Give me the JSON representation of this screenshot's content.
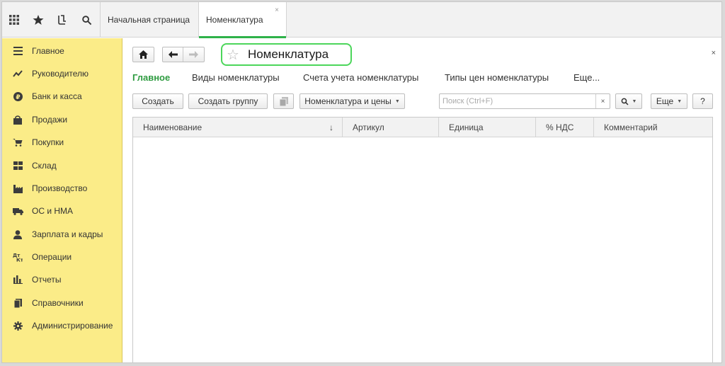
{
  "topbar": {
    "icons": [
      "apps-grid-icon",
      "favorites-star-icon",
      "history-icon",
      "search-icon"
    ],
    "tabs": [
      {
        "label": "Начальная страница"
      },
      {
        "label": "Номенклатура",
        "close": "×"
      }
    ]
  },
  "sidebar": {
    "items": [
      {
        "label": "Главное",
        "icon": "menu-lines-icon"
      },
      {
        "label": "Руководителю",
        "icon": "trend-chart-icon"
      },
      {
        "label": "Банк и касса",
        "icon": "ruble-coin-icon"
      },
      {
        "label": "Продажи",
        "icon": "shopping-bag-icon"
      },
      {
        "label": "Покупки",
        "icon": "cart-icon"
      },
      {
        "label": "Склад",
        "icon": "warehouse-grid-icon"
      },
      {
        "label": "Производство",
        "icon": "factory-icon"
      },
      {
        "label": "ОС и НМА",
        "icon": "truck-icon"
      },
      {
        "label": "Зарплата и кадры",
        "icon": "person-icon"
      },
      {
        "label": "Операции",
        "icon": "debit-credit-icon"
      },
      {
        "label": "Отчеты",
        "icon": "bar-chart-icon"
      },
      {
        "label": "Справочники",
        "icon": "book-icon"
      },
      {
        "label": "Администрирование",
        "icon": "gear-icon"
      }
    ]
  },
  "main": {
    "title": "Номенклатура",
    "close": "×",
    "subnav": [
      "Главное",
      "Виды номенклатуры",
      "Счета учета номенклатуры",
      "Типы цен номенклатуры",
      "Еще..."
    ],
    "toolbar": {
      "create": "Создать",
      "create_group": "Создать группу",
      "nomenclature_prices": "Номенклатура и цены",
      "search_placeholder": "Поиск (Ctrl+F)",
      "search_clear": "×",
      "more": "Еще",
      "help": "?"
    },
    "table": {
      "columns": [
        "Наименование",
        "Артикул",
        "Единица",
        "% НДС",
        "Комментарий"
      ],
      "sort_indicator": "↓",
      "rows": []
    }
  },
  "colors": {
    "sidebar_bg": "#fbec88",
    "accent_green": "#2fb24a",
    "title_highlight": "#4cd65b"
  }
}
